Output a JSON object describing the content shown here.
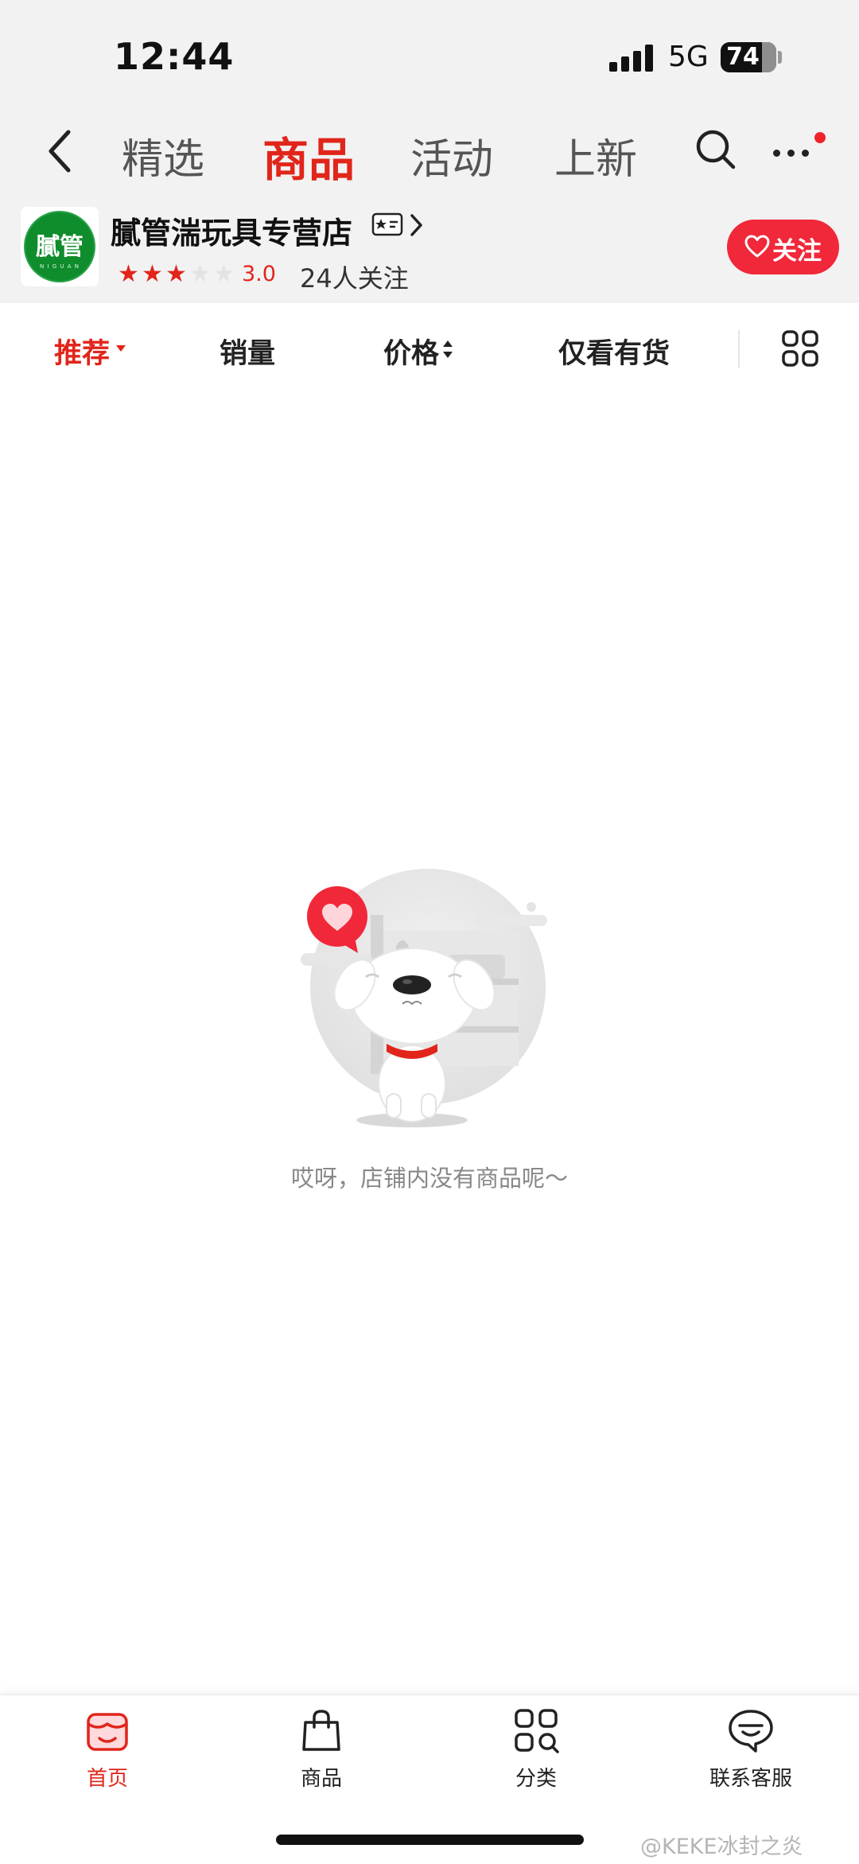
{
  "status": {
    "time": "12:44",
    "network": "5G",
    "battery": "74",
    "battery_level": 0.74
  },
  "nav": {
    "back_icon": "chevron-left-icon",
    "tabs": [
      {
        "label": "精选",
        "active": false
      },
      {
        "label": "商品",
        "active": true
      },
      {
        "label": "活动",
        "active": false
      },
      {
        "label": "上新",
        "active": false
      }
    ],
    "search_icon": "search-icon",
    "more_icon": "more-icon",
    "notification_dot_color": "#f0232b"
  },
  "shop": {
    "logo_text": "膩管",
    "logo_subtext": "N I G U A N",
    "name": "膩管湍玩具专营店",
    "rating_stars": 3,
    "rating_max": 5,
    "rating": "3.0",
    "followers": "24人关注",
    "follow_button": "关注"
  },
  "filters": [
    {
      "label": "推荐",
      "active": true
    },
    {
      "label": "销量",
      "active": false
    },
    {
      "label": "价格",
      "active": false
    },
    {
      "label": "仅看有货",
      "active": false
    }
  ],
  "empty_state": {
    "message": "哎呀，店铺内没有商品呢～"
  },
  "bottom_nav": [
    {
      "label": "首页",
      "icon": "storefront-icon",
      "active": true
    },
    {
      "label": "商品",
      "icon": "shopping-bag-icon",
      "active": false
    },
    {
      "label": "分类",
      "icon": "category-icon",
      "active": false
    },
    {
      "label": "联系客服",
      "icon": "customer-service-icon",
      "active": false
    }
  ],
  "watermark": "@KEKE冰封之炎",
  "colors": {
    "accent": "#e1251b",
    "follow_button": "#f0283a",
    "logo_green": "#0f8c2c"
  }
}
